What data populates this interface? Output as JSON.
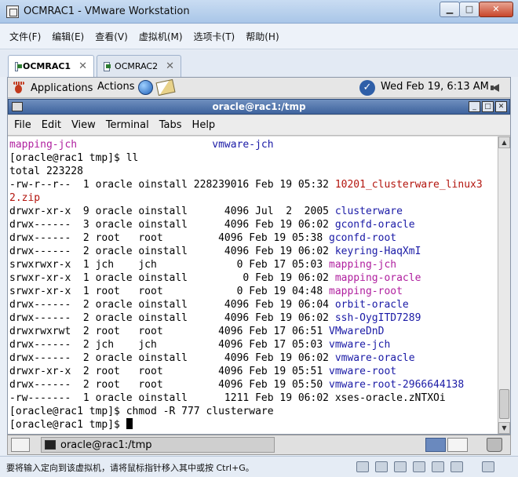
{
  "window": {
    "title": "OCMRAC1 - VMware Workstation"
  },
  "menu": [
    "文件(F)",
    "编辑(E)",
    "查看(V)",
    "虚拟机(M)",
    "选项卡(T)",
    "帮助(H)"
  ],
  "tabs": [
    {
      "label": "OCMRAC1",
      "active": true
    },
    {
      "label": "OCMRAC2",
      "active": false
    }
  ],
  "gnome_panel": {
    "applications": "Applications",
    "actions": "Actions",
    "clock": "Wed Feb 19,  6:13 AM"
  },
  "terminal": {
    "title": "oracle@rac1:/tmp",
    "menu": [
      "File",
      "Edit",
      "View",
      "Terminal",
      "Tabs",
      "Help"
    ],
    "lines": [
      [
        {
          "t": "mapping-jch",
          "c": "sock"
        },
        {
          "t": "                      ",
          "c": ""
        },
        {
          "t": "vmware-jch",
          "c": "dir"
        }
      ],
      [
        {
          "t": "[oracle@rac1 tmp]$ ll",
          "c": ""
        }
      ],
      [
        {
          "t": "total 223228",
          "c": ""
        }
      ],
      [
        {
          "t": "-rw-r--r--  1 oracle oinstall 228239016 Feb 19 05:32 ",
          "c": ""
        },
        {
          "t": "10201_clusterware_linux3",
          "c": "arch"
        }
      ],
      [
        {
          "t": "2.zip",
          "c": "arch"
        }
      ],
      [
        {
          "t": "drwxr-xr-x  9 oracle oinstall      4096 Jul  2  2005 ",
          "c": ""
        },
        {
          "t": "clusterware",
          "c": "dir"
        }
      ],
      [
        {
          "t": "drwx------  3 oracle oinstall      4096 Feb 19 06:02 ",
          "c": ""
        },
        {
          "t": "gconfd-oracle",
          "c": "dir"
        }
      ],
      [
        {
          "t": "drwx------  2 root   root         4096 Feb 19 05:38 ",
          "c": ""
        },
        {
          "t": "gconfd-root",
          "c": "dir"
        }
      ],
      [
        {
          "t": "drwx------  2 oracle oinstall      4096 Feb 19 06:02 ",
          "c": ""
        },
        {
          "t": "keyring-HaqXmI",
          "c": "dir"
        }
      ],
      [
        {
          "t": "srwxrwxr-x  1 jch    jch             0 Feb 17 05:03 ",
          "c": ""
        },
        {
          "t": "mapping-jch",
          "c": "sock"
        }
      ],
      [
        {
          "t": "srwxr-xr-x  1 oracle oinstall         0 Feb 19 06:02 ",
          "c": ""
        },
        {
          "t": "mapping-oracle",
          "c": "sock"
        }
      ],
      [
        {
          "t": "srwxr-xr-x  1 root   root            0 Feb 19 04:48 ",
          "c": ""
        },
        {
          "t": "mapping-root",
          "c": "sock"
        }
      ],
      [
        {
          "t": "drwx------  2 oracle oinstall      4096 Feb 19 06:04 ",
          "c": ""
        },
        {
          "t": "orbit-oracle",
          "c": "dir"
        }
      ],
      [
        {
          "t": "drwx------  2 oracle oinstall      4096 Feb 19 06:02 ",
          "c": ""
        },
        {
          "t": "ssh-OygITD7289",
          "c": "dir"
        }
      ],
      [
        {
          "t": "drwxrwxrwt  2 root   root         4096 Feb 17 06:51 ",
          "c": ""
        },
        {
          "t": "VMwareDnD",
          "c": "dir"
        }
      ],
      [
        {
          "t": "drwx------  2 jch    jch          4096 Feb 17 05:03 ",
          "c": ""
        },
        {
          "t": "vmware-jch",
          "c": "dir"
        }
      ],
      [
        {
          "t": "drwx------  2 oracle oinstall      4096 Feb 19 06:02 ",
          "c": ""
        },
        {
          "t": "vmware-oracle",
          "c": "dir"
        }
      ],
      [
        {
          "t": "drwxr-xr-x  2 root   root         4096 Feb 19 05:51 ",
          "c": ""
        },
        {
          "t": "vmware-root",
          "c": "dir"
        }
      ],
      [
        {
          "t": "drwx------  2 root   root         4096 Feb 19 05:50 ",
          "c": ""
        },
        {
          "t": "vmware-root-2966644138",
          "c": "dir"
        }
      ],
      [
        {
          "t": "-rw-------  1 oracle oinstall      1211 Feb 19 06:02 xses-oracle.zNTXOi",
          "c": ""
        }
      ],
      [
        {
          "t": "[oracle@rac1 tmp]$ chmod -R 777 clusterware",
          "c": ""
        }
      ],
      [
        {
          "t": "[oracle@rac1 tmp]$ ",
          "c": ""
        }
      ]
    ]
  },
  "taskbar": {
    "task_label": "oracle@rac1:/tmp"
  },
  "statusbar": {
    "text": "要将输入定向到该虚拟机，请将鼠标指针移入其中或按 Ctrl+G。"
  }
}
